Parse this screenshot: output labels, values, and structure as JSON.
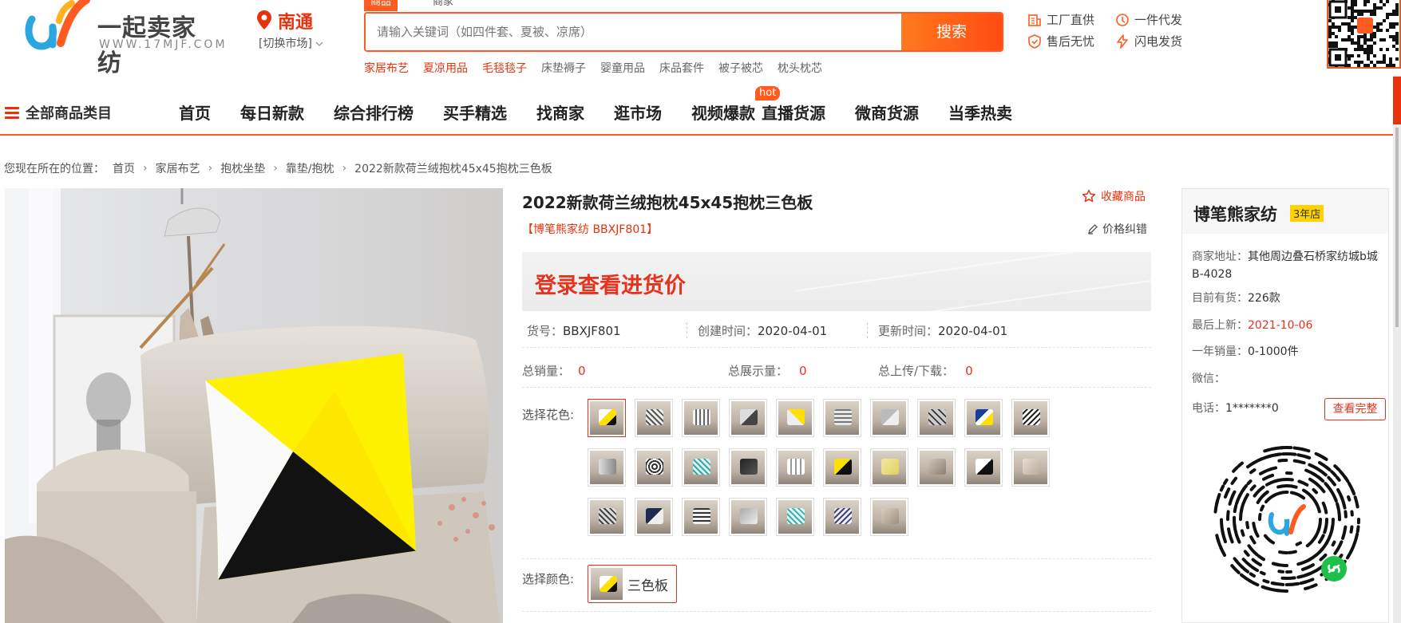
{
  "brand": {
    "name": "一起卖家纺",
    "domain": "WWW.17MJF.COM"
  },
  "location": {
    "city": "南通",
    "switch_label": "[切换市场]"
  },
  "search": {
    "tabs": [
      "商品",
      "商家"
    ],
    "placeholder": "请输入关键词（如四件套、夏被、凉席）",
    "button": "搜索",
    "hot": [
      {
        "label": "家居布艺",
        "highlight": true
      },
      {
        "label": "夏凉用品",
        "highlight": true
      },
      {
        "label": "毛毯毯子",
        "highlight": true
      },
      {
        "label": "床垫褥子",
        "highlight": false
      },
      {
        "label": "婴童用品",
        "highlight": false
      },
      {
        "label": "床品套件",
        "highlight": false
      },
      {
        "label": "被子被芯",
        "highlight": false
      },
      {
        "label": "枕头枕芯",
        "highlight": false
      }
    ]
  },
  "services": [
    "工厂直供",
    "一件代发",
    "售后无忧",
    "闪电发货"
  ],
  "nav": {
    "all_categories": "全部商品类目",
    "items": [
      "首页",
      "每日新款",
      "综合排行榜",
      "买手精选",
      "找商家",
      "逛市场",
      "视频爆款",
      "直播货源",
      "微商货源",
      "当季热卖"
    ],
    "hot_badge": "hot"
  },
  "breadcrumb": {
    "prefix": "您现在所在的位置：",
    "items": [
      "首页",
      "家居布艺",
      "抱枕坐垫",
      "靠垫/抱枕",
      "2022新款荷兰绒抱枕45x45抱枕三色板"
    ]
  },
  "product": {
    "title": "2022新款荷兰绒抱枕45x45抱枕三色板",
    "shop_code": "【博笔熊家纺 BBXJF801】",
    "favorite": "收藏商品",
    "price_fix": "价格纠错",
    "price_login": "登录查看进货价",
    "meta1": [
      {
        "label": "货号：",
        "value": "BBXJF801"
      },
      {
        "label": "创建时间：",
        "value": "2020-04-01"
      },
      {
        "label": "更新时间：",
        "value": "2020-04-01"
      }
    ],
    "meta2": [
      {
        "label": "总销量：",
        "value": "0"
      },
      {
        "label": "总展示量：",
        "value": "0"
      },
      {
        "label": "总上传/下载：",
        "value": "0"
      }
    ],
    "pattern_label": "选择花色:",
    "color_label": "选择颜色:",
    "color_option": "三色板"
  },
  "shop": {
    "name": "博笔熊家纺",
    "years": "3年店",
    "address_label": "商家地址：",
    "address": "其他周边叠石桥家纺城b城B-4028",
    "stock_label": "目前有货：",
    "stock": "226款",
    "latest_label": "最后上新：",
    "latest": "2021-10-06",
    "sales_label": "一年销量：",
    "sales": "0-1000件",
    "wechat_label": "微信：",
    "phone_label": "电话：",
    "phone": "1*******0",
    "view_all": "查看完整"
  },
  "colors": {
    "accent": "#ff5a1f",
    "red": "#e8321e",
    "yellow": "#ffd200"
  }
}
